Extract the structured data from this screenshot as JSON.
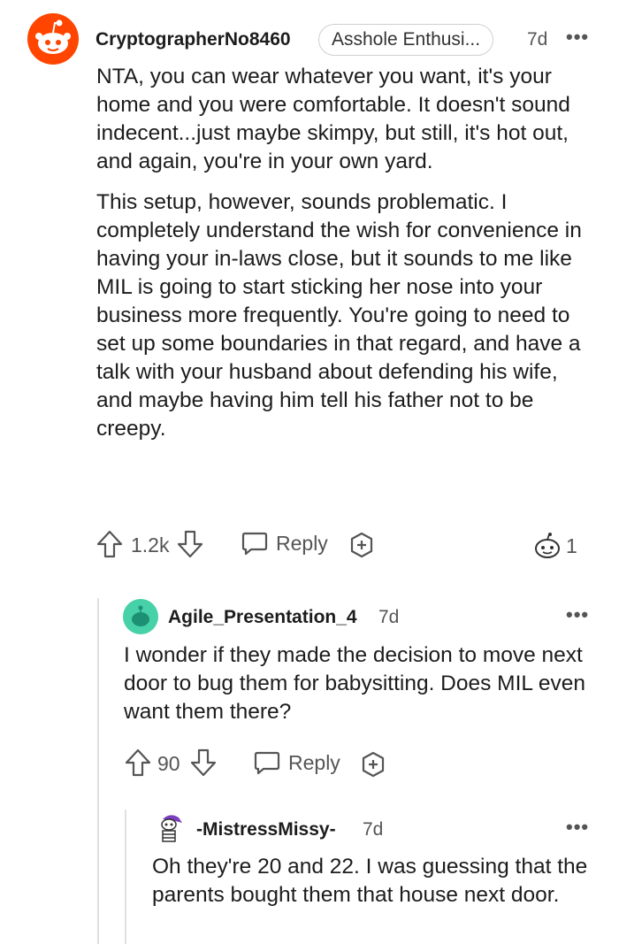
{
  "comments": [
    {
      "username": "CryptographerNo8460",
      "flair": "Asshole Enthusi...",
      "time": "7d",
      "paragraphs": [
        "NTA, you can wear whatever you want, it's your home and you were comfortable. It doesn't sound indecent...just maybe skimpy, but still, it's hot out, and again, you're in your own yard.",
        "This setup, however, sounds problematic. I completely understand the wish for convenience in having your in-laws close, but it sounds to me like MIL is going to start sticking her nose into your business more frequently. You're going to need to set up some boundaries in that regard, and have a talk with your husband about defending his wife, and maybe having him tell his father not to be creepy."
      ],
      "votes": "1.2k",
      "reply_label": "Reply",
      "award_count": "1"
    },
    {
      "username": "Agile_Presentation_4",
      "time": "7d",
      "text": "I wonder if they made the decision to move next door to bug them for babysitting. Does MIL even want them there?",
      "votes": "90",
      "reply_label": "Reply"
    },
    {
      "username": "-MistressMissy-",
      "time": "7d",
      "text": "Oh they're 20 and 22. I was guessing that the parents bought them that house next door."
    }
  ],
  "colors": {
    "snoo_orange": "#ff4500",
    "snoo_teal": "#46d1a8",
    "text": "#1c1c1c",
    "muted": "#555555"
  }
}
